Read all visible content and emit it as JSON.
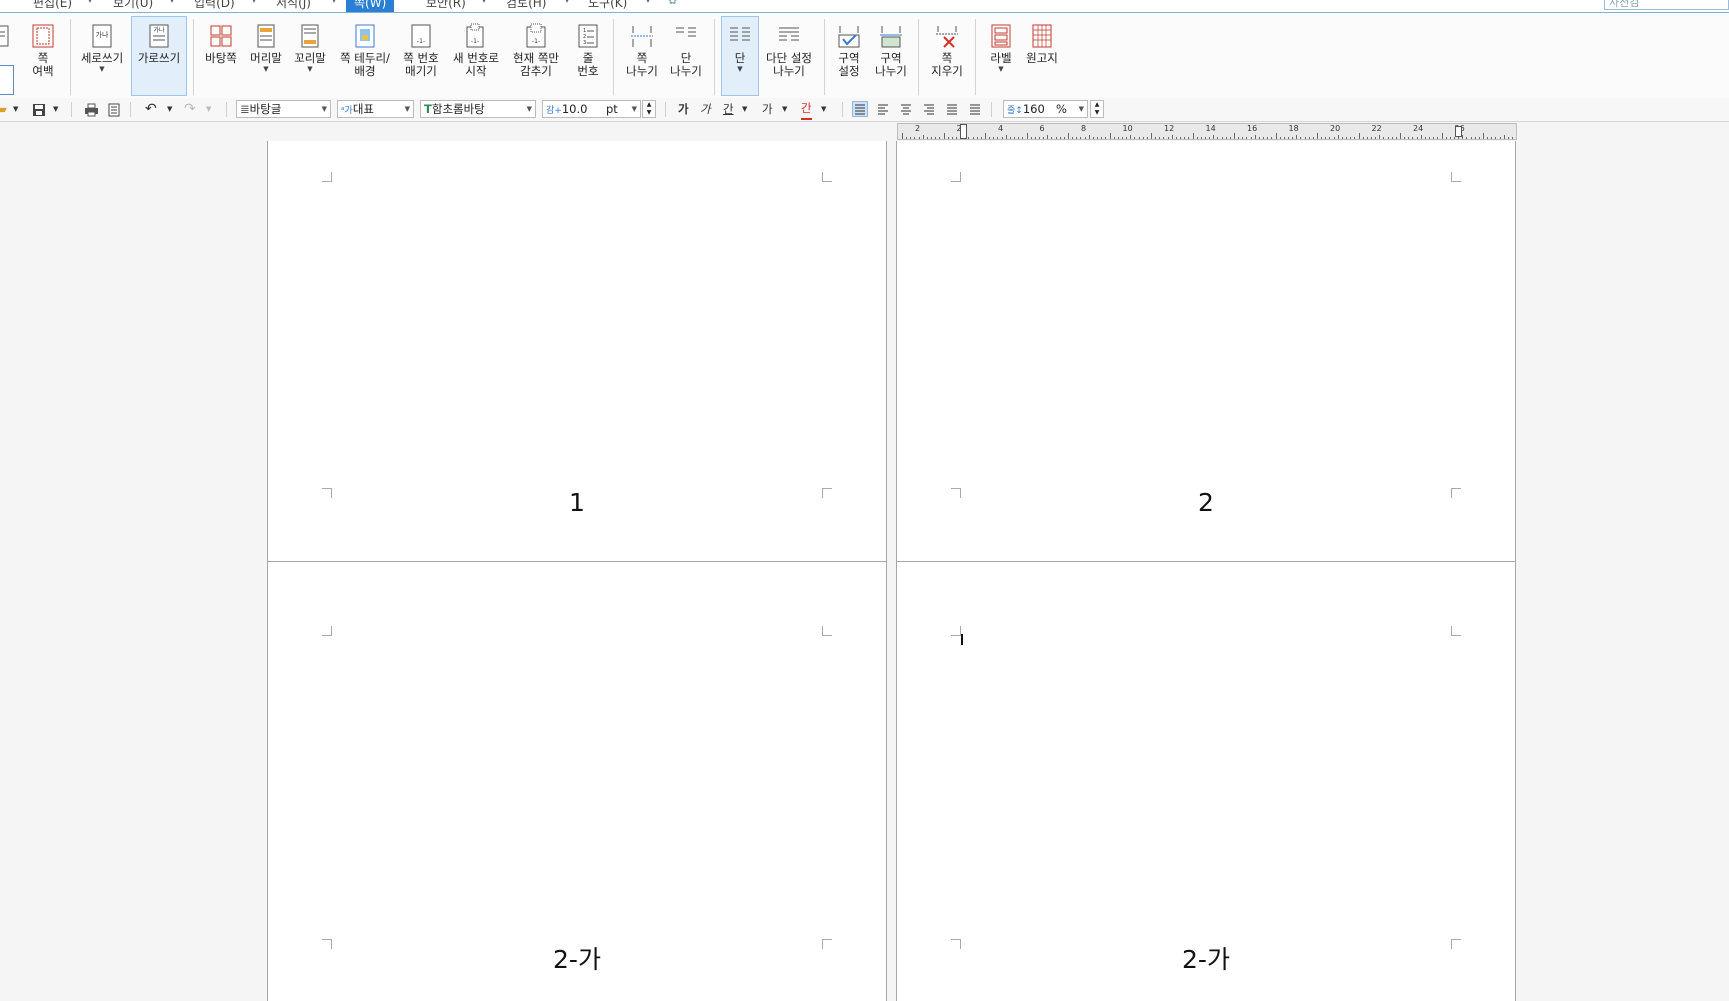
{
  "menubar": {
    "items": [
      "편집(E)",
      "보기(U)",
      "입력(D)",
      "서식(J)",
      "쪽(W)",
      "보안(R)",
      "검토(H)",
      "도구(K)"
    ],
    "active_item": "쪽(W)",
    "search_placeholder": "사전검"
  },
  "ribbon": {
    "page_margin": "쪽\n여백",
    "vertical_writing": "세로쓰기",
    "horizontal_writing": "가로쓰기",
    "background_page": "바탕쪽",
    "header": "머리말",
    "footer": "꼬리말",
    "border_background": "쪽 테두리/\n배경",
    "page_numbering": "쪽 번호\n매기기",
    "new_number_start": "새 번호로\n시작",
    "hide_current_page": "현재 쪽만\n감추기",
    "line_number": "줄\n번호",
    "page_break": "쪽\n나누기",
    "column_break": "단\n나누기",
    "columns": "단",
    "multi_column_break": "다단 설정\n나누기",
    "section_setting": "구역\n설정",
    "section_break": "구역\n나누기",
    "delete_page": "쪽\n지우기",
    "label": "라벨",
    "manuscript_paper": "원고지"
  },
  "format_toolbar": {
    "style": "바탕글",
    "language": "대표",
    "font": "함초롬바탕",
    "font_size": "10.0",
    "size_unit": "pt",
    "zoom": "160",
    "zoom_unit": "%",
    "bold": "가",
    "italic": "가",
    "underline": "간",
    "strike": "가",
    "font_color": "간",
    "font_color_value": "#d93025"
  },
  "ruler": {
    "labels": [
      "2",
      "2",
      "4",
      "6",
      "8",
      "10",
      "12",
      "14",
      "16",
      "18",
      "20",
      "22",
      "24",
      "26"
    ]
  },
  "pages": [
    {
      "number_text": "1"
    },
    {
      "number_text": "2"
    },
    {
      "number_text": "2-가"
    },
    {
      "number_text": "2-가"
    }
  ],
  "colors": {
    "accent": "#2a7fd4",
    "selected_bg": "#e2eef9"
  }
}
